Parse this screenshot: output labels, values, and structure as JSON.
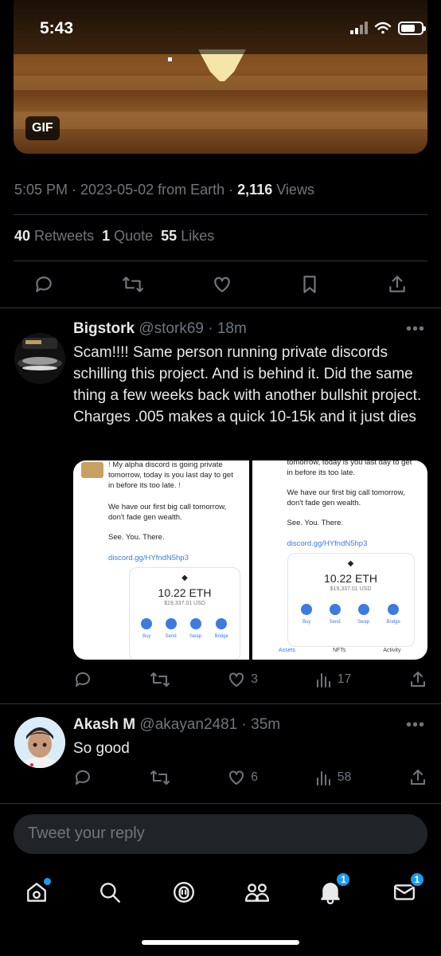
{
  "status_bar": {
    "time": "5:43"
  },
  "gif": {
    "badge": "GIF"
  },
  "tweet_meta": {
    "time": "5:05 PM",
    "date": "2023-05-02",
    "source": "from Earth",
    "views_count": "2,116",
    "views_label": "Views"
  },
  "tweet_stats": {
    "retweets_count": "40",
    "retweets_label": "Retweets",
    "quotes_count": "1",
    "quotes_label": "Quote",
    "likes_count": "55",
    "likes_label": "Likes"
  },
  "replies": [
    {
      "name": "Bigstork",
      "handle": "@stork69",
      "age": "18m",
      "text": "Scam!!!! Same person running private discords schilling this project. And is behind it. Did the same thing a few weeks back with another bullshit project. Charges .005 makes a quick 10-15k and it just dies",
      "likes": "3",
      "views": "17",
      "media": {
        "left": {
          "line1": "My alpha discord is going private tomorrow, today is you last day to get in before its too late.",
          "line2": "We have our first big call tomorrow, don't fade gen wealth.",
          "line3": "See. You. There.",
          "link": "discord.gg/HYfndN5hp3",
          "eth": "10.22 ETH",
          "usd": "$19,337.01 USD",
          "buttons": [
            "Buy",
            "Send",
            "Swap",
            "Bridge"
          ]
        },
        "right": {
          "line1": "tomorrow, today is you last day to get in before its too late.",
          "line2": "We have our first big call tomorrow, don't fade gen wealth.",
          "line3": "See. You. There.",
          "link": "discord.gg/HYfndN5hp3",
          "eth": "10.22 ETH",
          "usd": "$19,337.01 USD",
          "buttons": [
            "Buy",
            "Send",
            "Swap",
            "Bridge"
          ],
          "tabs": [
            "Assets",
            "NFTs",
            "Activity"
          ]
        }
      }
    },
    {
      "name": "Akash M",
      "handle": "@akayan2481",
      "age": "35m",
      "text": "So good",
      "likes": "6",
      "views": "58"
    }
  ],
  "compose": {
    "placeholder": "Tweet your reply"
  },
  "tabbar": {
    "notifications_badge": "1",
    "messages_badge": "1"
  },
  "colors": {
    "accent": "#1d9bf0",
    "muted": "#71767b",
    "background": "#000000"
  }
}
